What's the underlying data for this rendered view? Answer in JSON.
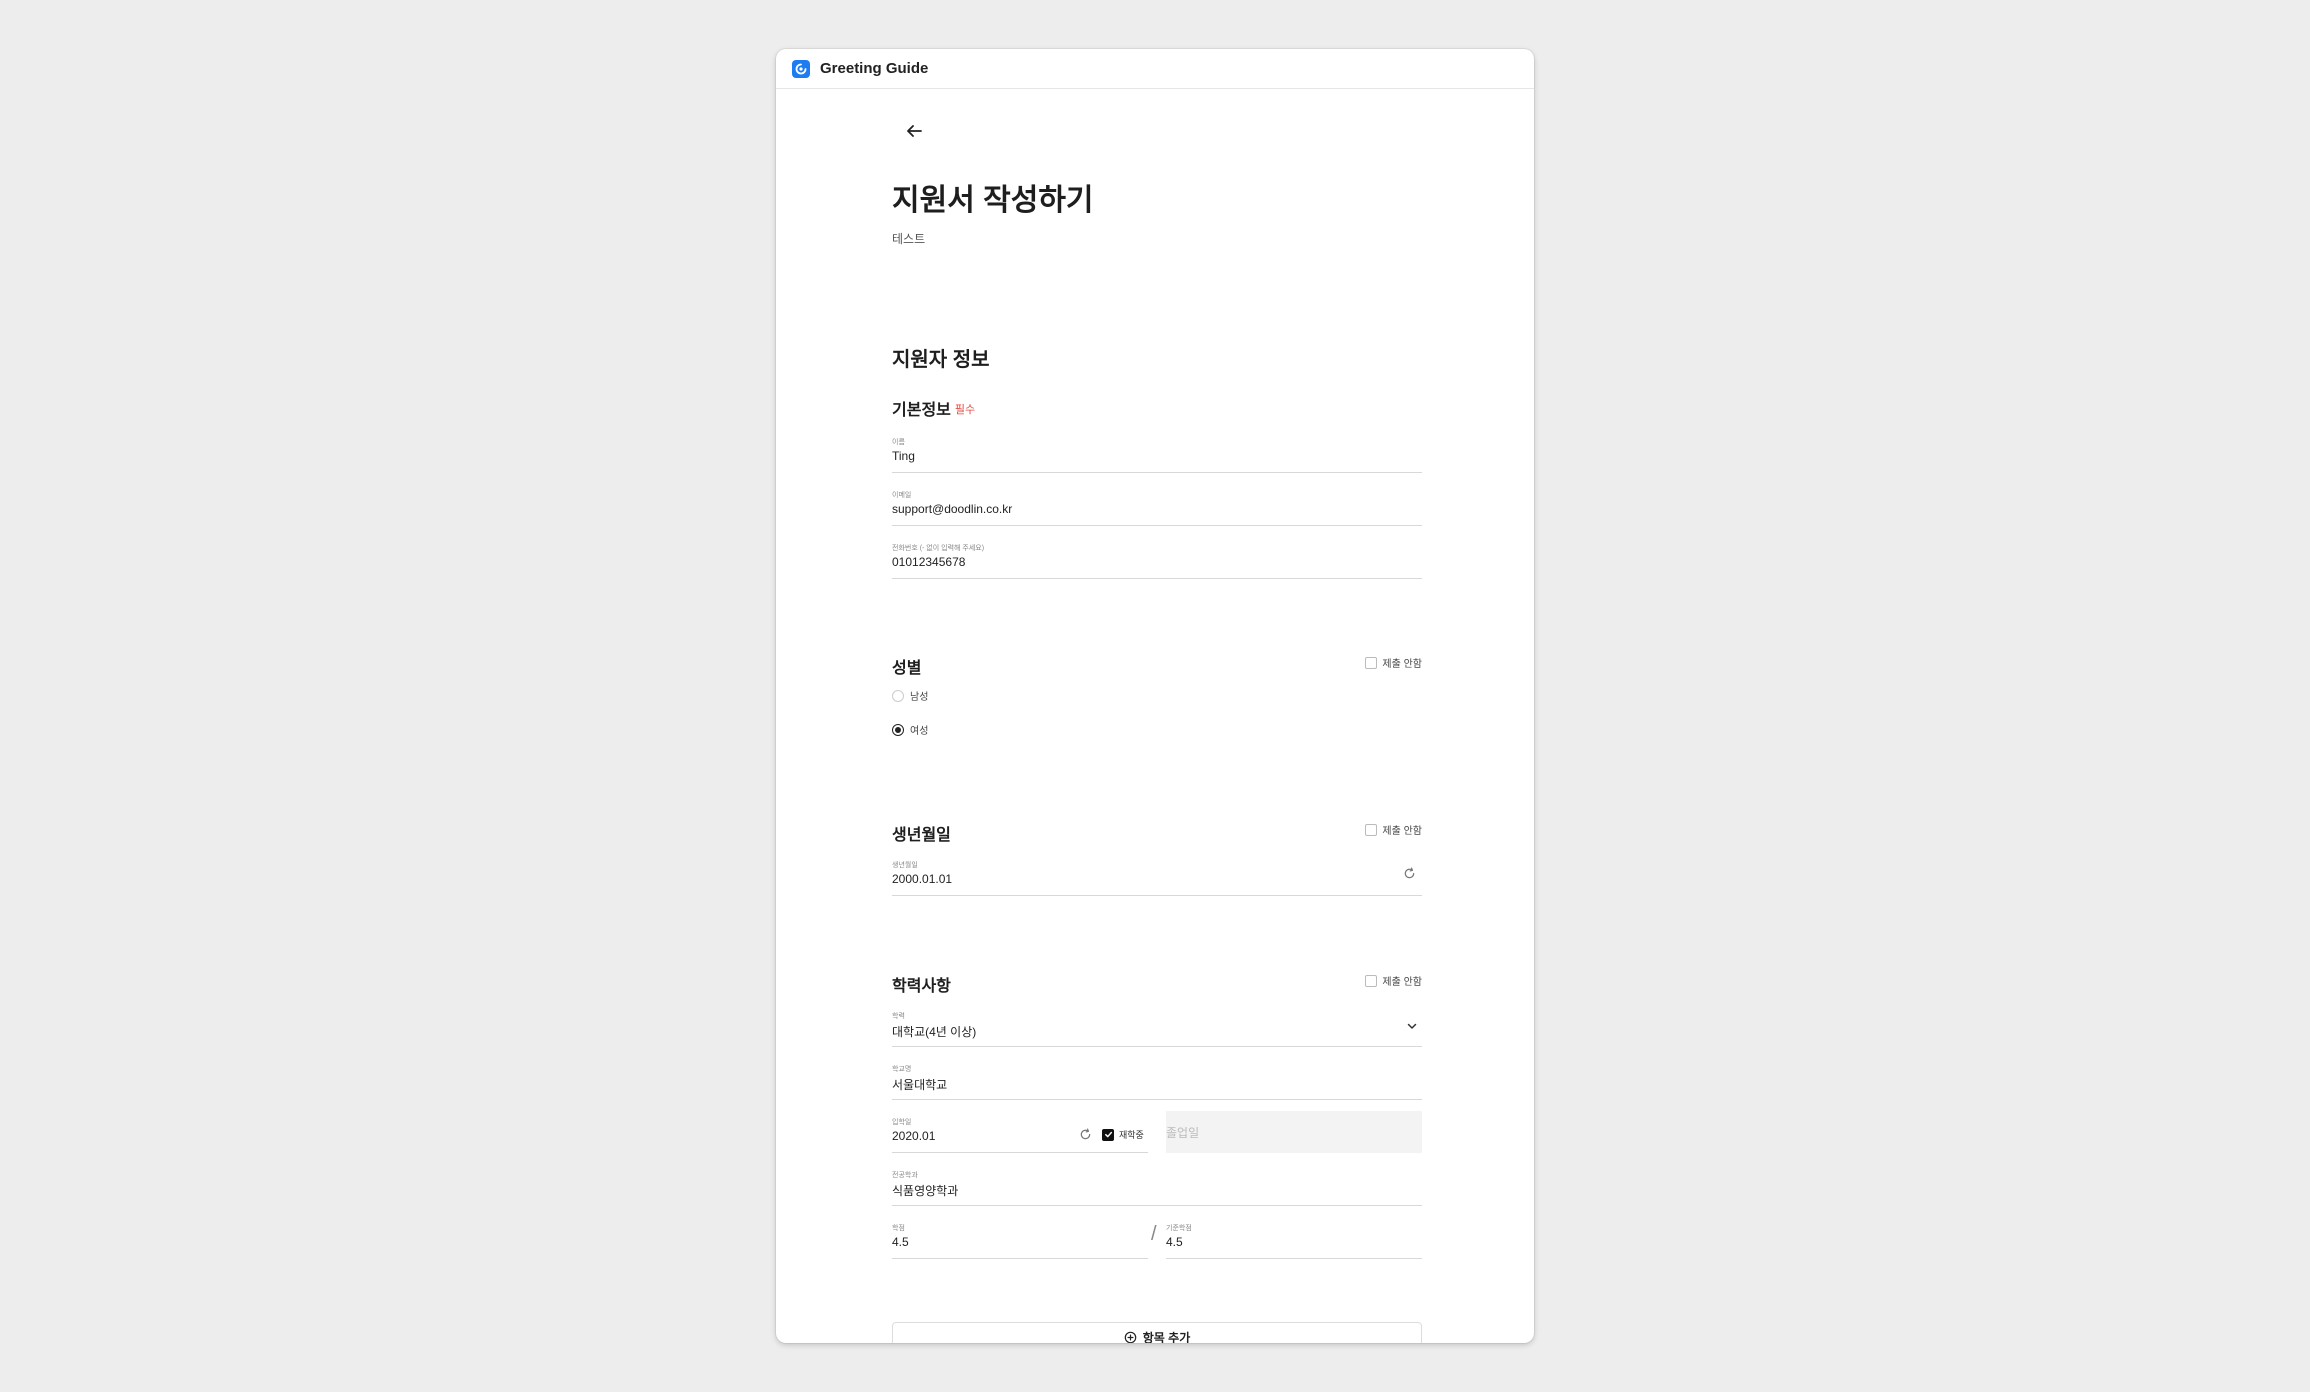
{
  "app": {
    "title": "Greeting Guide"
  },
  "page": {
    "title": "지원서 작성하기",
    "subtitle": "테스트"
  },
  "section": {
    "title": "지원자 정보"
  },
  "basic": {
    "title": "기본정보",
    "required": "필수",
    "name": {
      "label": "이름",
      "value": "Ting"
    },
    "email": {
      "label": "이메일",
      "value": "support@doodlin.co.kr"
    },
    "phone": {
      "label": "전화번호 (- 없이 입력해 주세요)",
      "value": "01012345678"
    }
  },
  "gender": {
    "title": "성별",
    "no_submit": "제출 안함",
    "options": [
      {
        "label": "남성",
        "selected": false
      },
      {
        "label": "여성",
        "selected": true
      }
    ]
  },
  "birth": {
    "title": "생년월일",
    "no_submit": "제출 안함",
    "label": "생년월일",
    "value": "2000.01.01"
  },
  "education": {
    "title": "학력사항",
    "no_submit": "제출 안함",
    "degree": {
      "label": "학력",
      "value": "대학교(4년 이상)"
    },
    "school": {
      "label": "학교명",
      "value": "서울대학교"
    },
    "admission": {
      "label": "입학일",
      "value": "2020.01"
    },
    "enrolled_label": "재학중",
    "graduation_placeholder": "졸업일",
    "major": {
      "label": "전공학과",
      "value": "식품영양학과"
    },
    "gpa": {
      "label": "학점",
      "value": "4.5"
    },
    "gpa_max": {
      "label": "기준학점",
      "value": "4.5"
    }
  },
  "add_item": "항목 추가"
}
